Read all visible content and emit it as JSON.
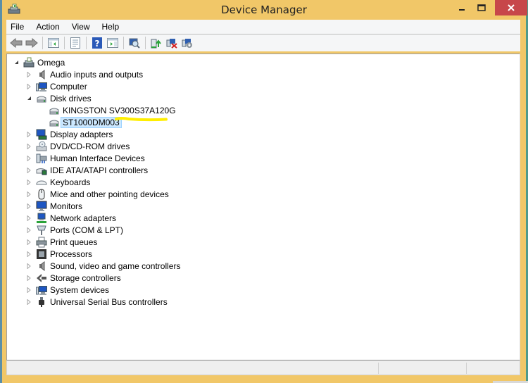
{
  "window": {
    "title": "Device Manager",
    "controls": {
      "minimize": "–",
      "maximize": "□",
      "close": "×"
    },
    "frame_color": "#f1c768",
    "close_color": "#c7474a"
  },
  "menu": [
    "File",
    "Action",
    "View",
    "Help"
  ],
  "toolbar": [
    {
      "icon": "back-arrow-icon"
    },
    {
      "icon": "forward-arrow-icon"
    },
    {
      "sep": true
    },
    {
      "icon": "show-hide-console-tree-icon"
    },
    {
      "sep": true
    },
    {
      "icon": "properties-icon"
    },
    {
      "sep": true
    },
    {
      "icon": "help-icon"
    },
    {
      "icon": "show-action-pane-icon"
    },
    {
      "sep": true
    },
    {
      "icon": "scan-hardware-changes-icon"
    },
    {
      "sep": true
    },
    {
      "icon": "update-driver-icon"
    },
    {
      "icon": "uninstall-device-icon"
    },
    {
      "icon": "disable-device-icon"
    }
  ],
  "tree": {
    "root": {
      "label": "Omega",
      "icon": "computer-root-icon",
      "expanded": true
    },
    "items": [
      {
        "label": "Audio inputs and outputs",
        "icon": "speaker-icon",
        "expanded": false
      },
      {
        "label": "Computer",
        "icon": "computer-icon",
        "expanded": false
      },
      {
        "label": "Disk drives",
        "icon": "disk-drive-icon",
        "expanded": true,
        "children": [
          {
            "label": "KINGSTON SV300S37A120G",
            "icon": "disk-drive-icon",
            "selected": false
          },
          {
            "label": "ST1000DM003",
            "icon": "disk-drive-icon",
            "selected": true
          }
        ]
      },
      {
        "label": "Display adapters",
        "icon": "display-adapter-icon",
        "expanded": false
      },
      {
        "label": "DVD/CD-ROM drives",
        "icon": "dvd-drive-icon",
        "expanded": false
      },
      {
        "label": "Human Interface Devices",
        "icon": "hid-icon",
        "expanded": false
      },
      {
        "label": "IDE ATA/ATAPI controllers",
        "icon": "ide-controller-icon",
        "expanded": false
      },
      {
        "label": "Keyboards",
        "icon": "keyboard-icon",
        "expanded": false
      },
      {
        "label": "Mice and other pointing devices",
        "icon": "mouse-icon",
        "expanded": false
      },
      {
        "label": "Monitors",
        "icon": "monitor-icon",
        "expanded": false
      },
      {
        "label": "Network adapters",
        "icon": "network-adapter-icon",
        "expanded": false
      },
      {
        "label": "Ports (COM & LPT)",
        "icon": "port-icon",
        "expanded": false
      },
      {
        "label": "Print queues",
        "icon": "printer-icon",
        "expanded": false
      },
      {
        "label": "Processors",
        "icon": "processor-icon",
        "expanded": false
      },
      {
        "label": "Sound, video and game controllers",
        "icon": "speaker-icon",
        "expanded": false
      },
      {
        "label": "Storage controllers",
        "icon": "storage-controller-icon",
        "expanded": false
      },
      {
        "label": "System devices",
        "icon": "system-device-icon",
        "expanded": false
      },
      {
        "label": "Universal Serial Bus controllers",
        "icon": "usb-icon",
        "expanded": false
      }
    ]
  },
  "annotation": {
    "type": "yellow-highlighter-mark",
    "color": "#ffee00"
  }
}
